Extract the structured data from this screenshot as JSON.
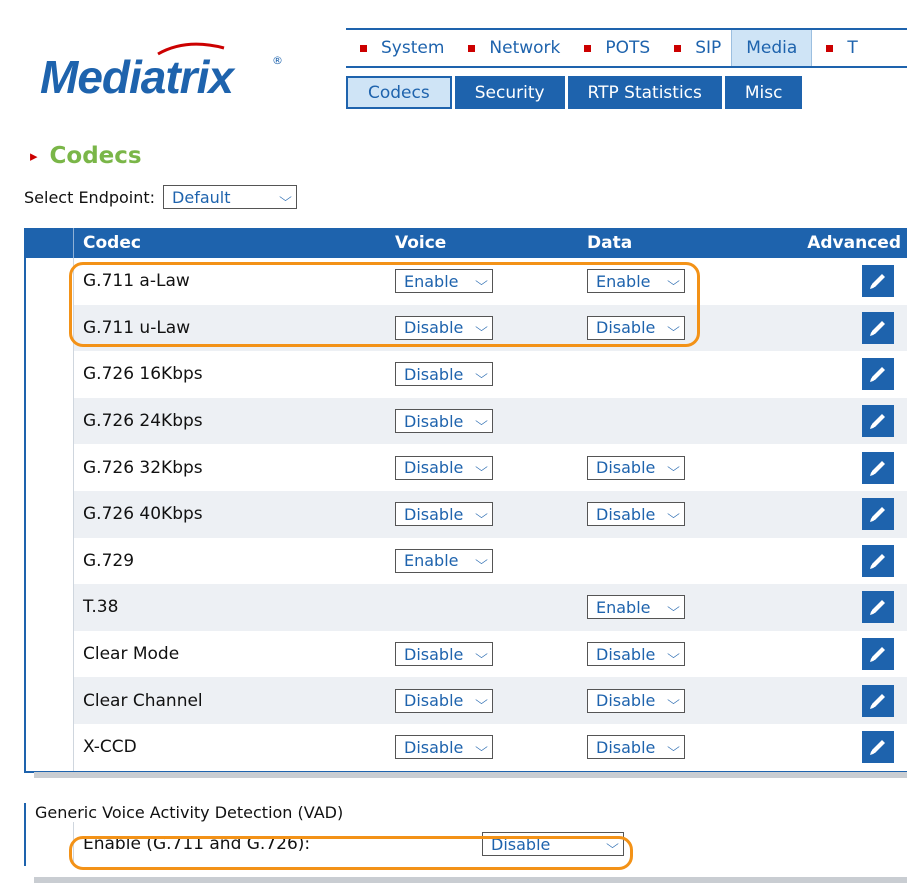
{
  "brand": {
    "name": "Mediatrix",
    "mark": "®"
  },
  "nav": {
    "items": [
      "System",
      "Network",
      "POTS",
      "SIP",
      "Media",
      "T"
    ],
    "active": "Media"
  },
  "subnav": {
    "tabs": [
      "Codecs",
      "Security",
      "RTP Statistics",
      "Misc"
    ],
    "active": "Codecs"
  },
  "page": {
    "title": "Codecs",
    "endpoint_label": "Select Endpoint:",
    "endpoint_value": "Default"
  },
  "codec_table": {
    "headers": {
      "codec": "Codec",
      "voice": "Voice",
      "data": "Data",
      "advanced": "Advanced"
    },
    "rows": [
      {
        "codec": "G.711 a-Law",
        "voice": "Enable",
        "data": "Enable"
      },
      {
        "codec": "G.711 u-Law",
        "voice": "Disable",
        "data": "Disable"
      },
      {
        "codec": "G.726 16Kbps",
        "voice": "Disable",
        "data": null
      },
      {
        "codec": "G.726 24Kbps",
        "voice": "Disable",
        "data": null
      },
      {
        "codec": "G.726 32Kbps",
        "voice": "Disable",
        "data": "Disable"
      },
      {
        "codec": "G.726 40Kbps",
        "voice": "Disable",
        "data": "Disable"
      },
      {
        "codec": "G.729",
        "voice": "Enable",
        "data": null
      },
      {
        "codec": "T.38",
        "voice": null,
        "data": "Enable"
      },
      {
        "codec": "Clear Mode",
        "voice": "Disable",
        "data": "Disable"
      },
      {
        "codec": "Clear Channel",
        "voice": "Disable",
        "data": "Disable"
      },
      {
        "codec": "X-CCD",
        "voice": "Disable",
        "data": "Disable"
      }
    ]
  },
  "vad": {
    "header": "Generic Voice Activity Detection (VAD)",
    "label": "Enable (G.711 and G.726):",
    "value": "Disable"
  },
  "colors": {
    "brand_blue": "#1e63ad",
    "heading_green": "#7ab648",
    "highlight_orange": "#f39217",
    "nav_marker_red": "#cc0000"
  }
}
